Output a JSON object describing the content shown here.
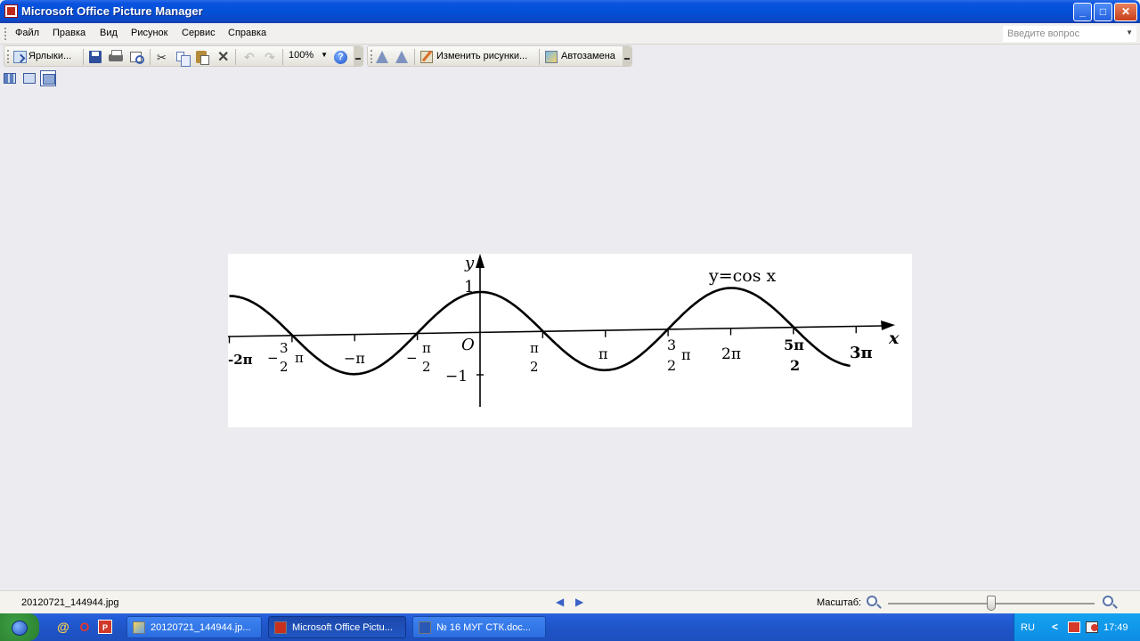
{
  "window": {
    "title": "Microsoft Office Picture Manager",
    "minimize": "_",
    "maximize": "□",
    "close": "✕"
  },
  "menu": {
    "items": [
      "Файл",
      "Правка",
      "Вид",
      "Рисунок",
      "Сервис",
      "Справка"
    ],
    "ask_placeholder": "Введите вопрос",
    "ask_arrow": "▼"
  },
  "toolbar": {
    "shortcuts_label": "Ярлыки...",
    "zoom_value": "100%",
    "zoom_arrow": "▼",
    "edit_pictures_label": "Изменить рисунки...",
    "autocorrect_label": "Автозамена",
    "help_glyph": "?",
    "cut_glyph": "✂",
    "delete_glyph": "✕",
    "undo_glyph": "↶",
    "redo_glyph": "↷"
  },
  "picture": {
    "y_axis": "y",
    "x_axis": "x",
    "origin": "O",
    "function_label": "y=cos x",
    "y_ticks": [
      "1",
      "−1"
    ],
    "x_labels": {
      "neg_2pi": "-2π",
      "neg_3pi_2_sign": "−",
      "neg_3pi_2_num": "3",
      "neg_3pi_2_den": "2",
      "neg_3pi_2_pi": "π",
      "neg_pi": "−π",
      "neg_pi_2_sign": "−",
      "neg_pi_2_num": "π",
      "neg_pi_2_den": "2",
      "pi_2_num": "π",
      "pi_2_den": "2",
      "pi": "π",
      "three_pi_2_num": "3",
      "three_pi_2_den": "2",
      "three_pi_2_pi": "π",
      "two_pi": "2π",
      "five_pi_2_num": "5π",
      "five_pi_2_den": "2",
      "three_pi": "3π"
    }
  },
  "chart_data": {
    "type": "line",
    "function": "cos",
    "x_range_rad": [
      -6.283,
      9.3
    ],
    "ylim": [
      -1,
      1
    ],
    "grid": false,
    "series": [
      {
        "name": "y=cos x",
        "x_start": -6.283,
        "x_end": 9.3
      }
    ]
  },
  "status": {
    "filename": "20120721_144944.jpg",
    "prev_glyph": "◀",
    "next_glyph": "▶",
    "zoom_label": "Масштаб:",
    "zoom_level_fraction": 0.5
  },
  "taskbar": {
    "tasks": [
      "20120721_144944.jp...",
      "Microsoft Office Pictu...",
      "№ 16  МУГ СТК.doc..."
    ],
    "mail_glyph": "@",
    "opera_glyph": "O",
    "office_glyph": "P",
    "lang": "RU",
    "tray_chevron": "<",
    "clock": "17:49"
  }
}
